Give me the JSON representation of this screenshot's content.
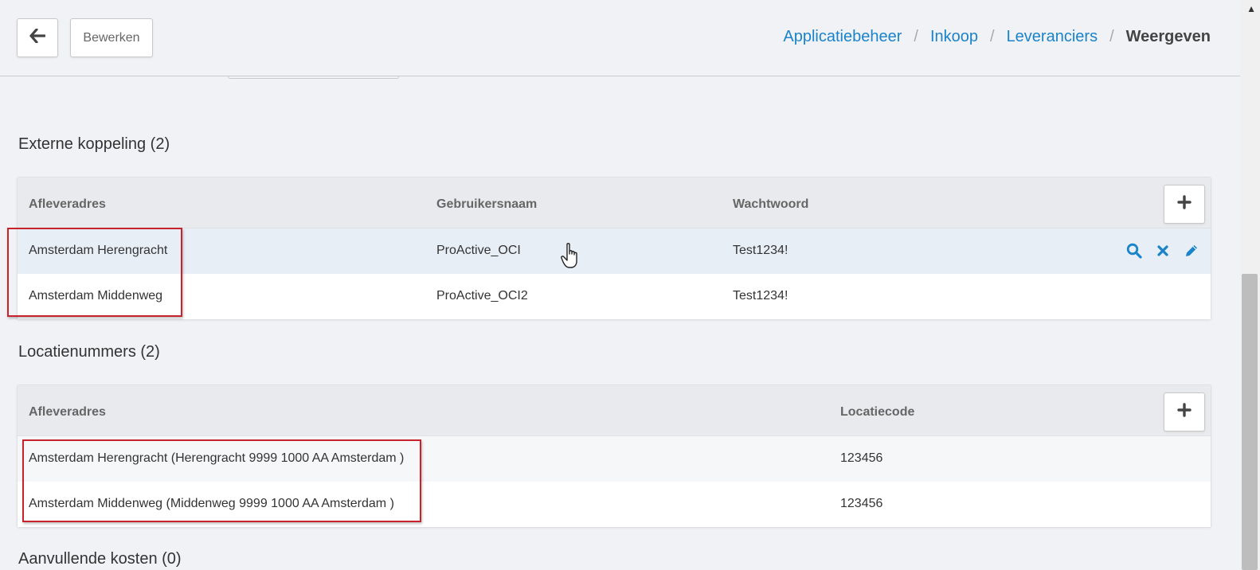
{
  "toolbar": {
    "edit_label": "Bewerken"
  },
  "breadcrumb": {
    "items": [
      "Applicatiebeheer",
      "Inkoop",
      "Leveranciers"
    ],
    "current": "Weergeven",
    "separator": "/"
  },
  "external": {
    "title": "Externe koppeling (2)",
    "columns": [
      "Afleveradres",
      "Gebruikersnaam",
      "Wachtwoord"
    ],
    "rows": [
      {
        "address": "Amsterdam Herengracht",
        "username": "ProActive_OCI",
        "password": "Test1234!"
      },
      {
        "address": "Amsterdam Middenweg",
        "username": "ProActive_OCI2",
        "password": "Test1234!"
      }
    ]
  },
  "locations": {
    "title": "Locatienummers (2)",
    "columns": [
      "Afleveradres",
      "Locatiecode"
    ],
    "rows": [
      {
        "address": "Amsterdam Herengracht (Herengracht 9999 1000 AA Amsterdam )",
        "code": "123456"
      },
      {
        "address": "Amsterdam Middenweg (Middenweg 9999 1000 AA Amsterdam )",
        "code": "123456"
      }
    ]
  },
  "extra_costs": {
    "title": "Aanvullende kosten (0)"
  },
  "colors": {
    "link": "#1a83c9",
    "highlight": "#c8232c",
    "row_hover": "#e8eef6"
  }
}
